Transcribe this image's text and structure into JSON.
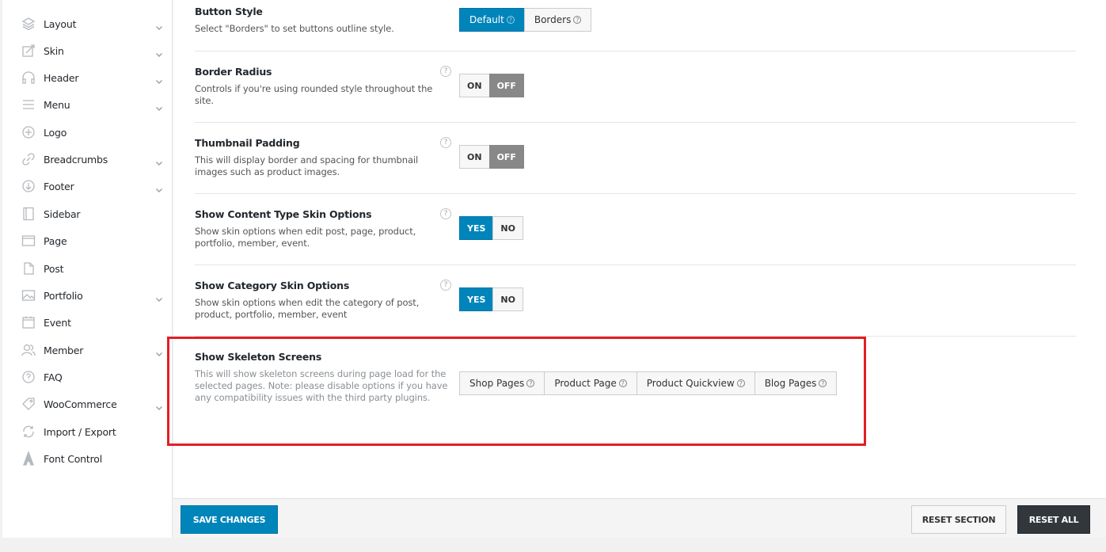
{
  "sidebar": {
    "items": [
      {
        "label": "Layout",
        "icon": "layers-icon",
        "chevron": true
      },
      {
        "label": "Skin",
        "icon": "paint-icon",
        "chevron": true
      },
      {
        "label": "Header",
        "icon": "headphones-icon",
        "chevron": true
      },
      {
        "label": "Menu",
        "icon": "menu-icon",
        "chevron": true
      },
      {
        "label": "Logo",
        "icon": "plus-circle-icon",
        "chevron": false
      },
      {
        "label": "Breadcrumbs",
        "icon": "link-icon",
        "chevron": true
      },
      {
        "label": "Footer",
        "icon": "arrow-down-circle-icon",
        "chevron": true
      },
      {
        "label": "Sidebar",
        "icon": "sidebar-icon",
        "chevron": false
      },
      {
        "label": "Page",
        "icon": "browser-icon",
        "chevron": false
      },
      {
        "label": "Post",
        "icon": "document-icon",
        "chevron": false
      },
      {
        "label": "Portfolio",
        "icon": "image-icon",
        "chevron": true
      },
      {
        "label": "Event",
        "icon": "calendar-icon",
        "chevron": false
      },
      {
        "label": "Member",
        "icon": "users-icon",
        "chevron": true
      },
      {
        "label": "FAQ",
        "icon": "help-circle-icon",
        "chevron": false
      },
      {
        "label": "WooCommerce",
        "icon": "tag-icon",
        "chevron": true
      },
      {
        "label": "Import / Export",
        "icon": "refresh-icon",
        "chevron": false
      },
      {
        "label": "Font Control",
        "icon": "font-icon",
        "chevron": false
      }
    ]
  },
  "settings": {
    "button_style": {
      "title": "Button Style",
      "desc": "Select \"Borders\" to set buttons outline style.",
      "options": [
        "Default",
        "Borders"
      ]
    },
    "border_radius": {
      "title": "Border Radius",
      "desc": "Controls if you're using rounded style throughout the site.",
      "on": "ON",
      "off": "OFF"
    },
    "thumbnail_padding": {
      "title": "Thumbnail Padding",
      "desc": "This will display border and spacing for thumbnail images such as product images.",
      "on": "ON",
      "off": "OFF"
    },
    "content_type_skin": {
      "title": "Show Content Type Skin Options",
      "desc": "Show skin options when edit post, page, product, portfolio, member, event.",
      "yes": "YES",
      "no": "NO"
    },
    "category_skin": {
      "title": "Show Category Skin Options",
      "desc": "Show skin options when edit the category of post, product, portfolio, member, event",
      "yes": "YES",
      "no": "NO"
    },
    "skeleton": {
      "title": "Show Skeleton Screens",
      "desc": "This will show skeleton screens during page load for the selected pages. Note: please disable options if you have any compatibility issues with the third party plugins.",
      "options": [
        "Shop Pages",
        "Product Page",
        "Product Quickview",
        "Blog Pages"
      ]
    }
  },
  "footer": {
    "save": "SAVE CHANGES",
    "reset_section": "RESET SECTION",
    "reset_all": "RESET ALL"
  },
  "help_glyph": "?",
  "colors": {
    "accent": "#0085ba",
    "highlight": "#e21e25",
    "dark": "#32373c"
  }
}
